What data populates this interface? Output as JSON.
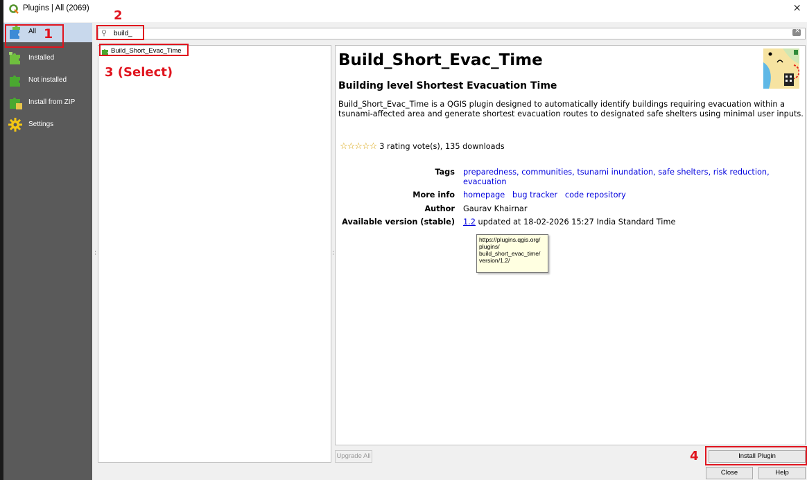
{
  "window": {
    "title": "Plugins | All (2069)",
    "close_glyph": "×"
  },
  "sidebar": {
    "items": [
      {
        "label": "All",
        "icon": "plugins-all-icon",
        "active": true
      },
      {
        "label": "Installed",
        "icon": "plugins-installed-icon"
      },
      {
        "label": "Not installed",
        "icon": "plugins-not-installed-icon"
      },
      {
        "label": "Install from ZIP",
        "icon": "install-zip-icon"
      },
      {
        "label": "Settings",
        "icon": "settings-gear-icon"
      }
    ]
  },
  "search": {
    "value": "build_",
    "icon": "search-icon",
    "clear_icon": "clear-icon"
  },
  "list": {
    "items": [
      {
        "label": "Build_Short_Evac_Time",
        "icon": "plugin-icon"
      }
    ]
  },
  "details": {
    "name": "Build_Short_Evac_Time",
    "subtitle": "Building level Shortest Evacuation Time",
    "description": "Build_Short_Evac_Time is a QGIS plugin designed to automatically identify buildings requiring evacuation within a tsunami-affected area and generate shortest evacuation routes to designated safe shelters using minimal user inputs.",
    "rating": {
      "stars_glyph": "☆☆☆☆☆",
      "stars_filled": 0,
      "text": "3 rating vote(s), 135 downloads"
    },
    "tags_label": "Tags",
    "tags_line1": "preparedness, communities, tsunami inundation, safe shelters, risk reduction,",
    "tags_line2": "evacuation",
    "more_info_label": "More info",
    "more_info_links": {
      "homepage": "homepage",
      "bug_tracker": "bug tracker",
      "code_repository": "code repository"
    },
    "author_label": "Author",
    "author": "Gaurav Khairnar",
    "version_label": "Available version (stable)",
    "version": "1.2",
    "version_suffix": " updated at 18-02-2026 15:27 India Standard Time",
    "tooltip_lines": [
      "https://plugins.qgis.org/",
      "plugins/",
      "build_short_evac_time/",
      "version/1.2/"
    ]
  },
  "buttons": {
    "upgrade_all": "Upgrade All",
    "install_plugin": "Install Plugin",
    "close": "Close",
    "help": "Help"
  },
  "annotations": {
    "step1": "1",
    "step2": "2",
    "step3": "3 (Select)",
    "step4": "4",
    "color": "#e0141e"
  },
  "colors": {
    "sidebar_bg": "#5a5a5a",
    "active_item_bg": "#c8d8ec",
    "link": "#0000dd",
    "tooltip_bg": "#ffffe1"
  }
}
